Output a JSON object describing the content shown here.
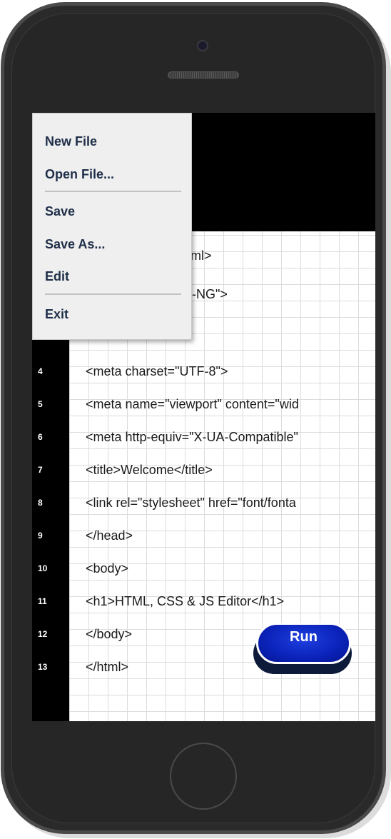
{
  "menu": {
    "items": [
      "New File",
      "Open File...",
      "Save",
      "Save As...",
      "Edit",
      "Exit"
    ]
  },
  "editor": {
    "line_numbers": [
      "4",
      "5",
      "6",
      "7",
      "8",
      "9",
      "10",
      "11",
      "12",
      "13"
    ],
    "partial_lines": [
      "tml>",
      "n-NG\">"
    ],
    "lines": [
      "<meta charset=\"UTF-8\">",
      "<meta name=\"viewport\" content=\"wid",
      "<meta http-equiv=\"X-UA-Compatible\"",
      "<title>Welcome</title>",
      "<link rel=\"stylesheet\" href=\"font/fonta",
      "</head>",
      "<body>",
      "<h1>HTML, CSS & JS Editor</h1>",
      "</body>",
      "</html>"
    ]
  },
  "run_button": {
    "label": "Run"
  },
  "colors": {
    "phone_body": "#2a2a2a",
    "menu_bg": "#efefef",
    "menu_text": "#1e2e48",
    "run_button": "#0a22b8",
    "gutter": "#000000"
  }
}
